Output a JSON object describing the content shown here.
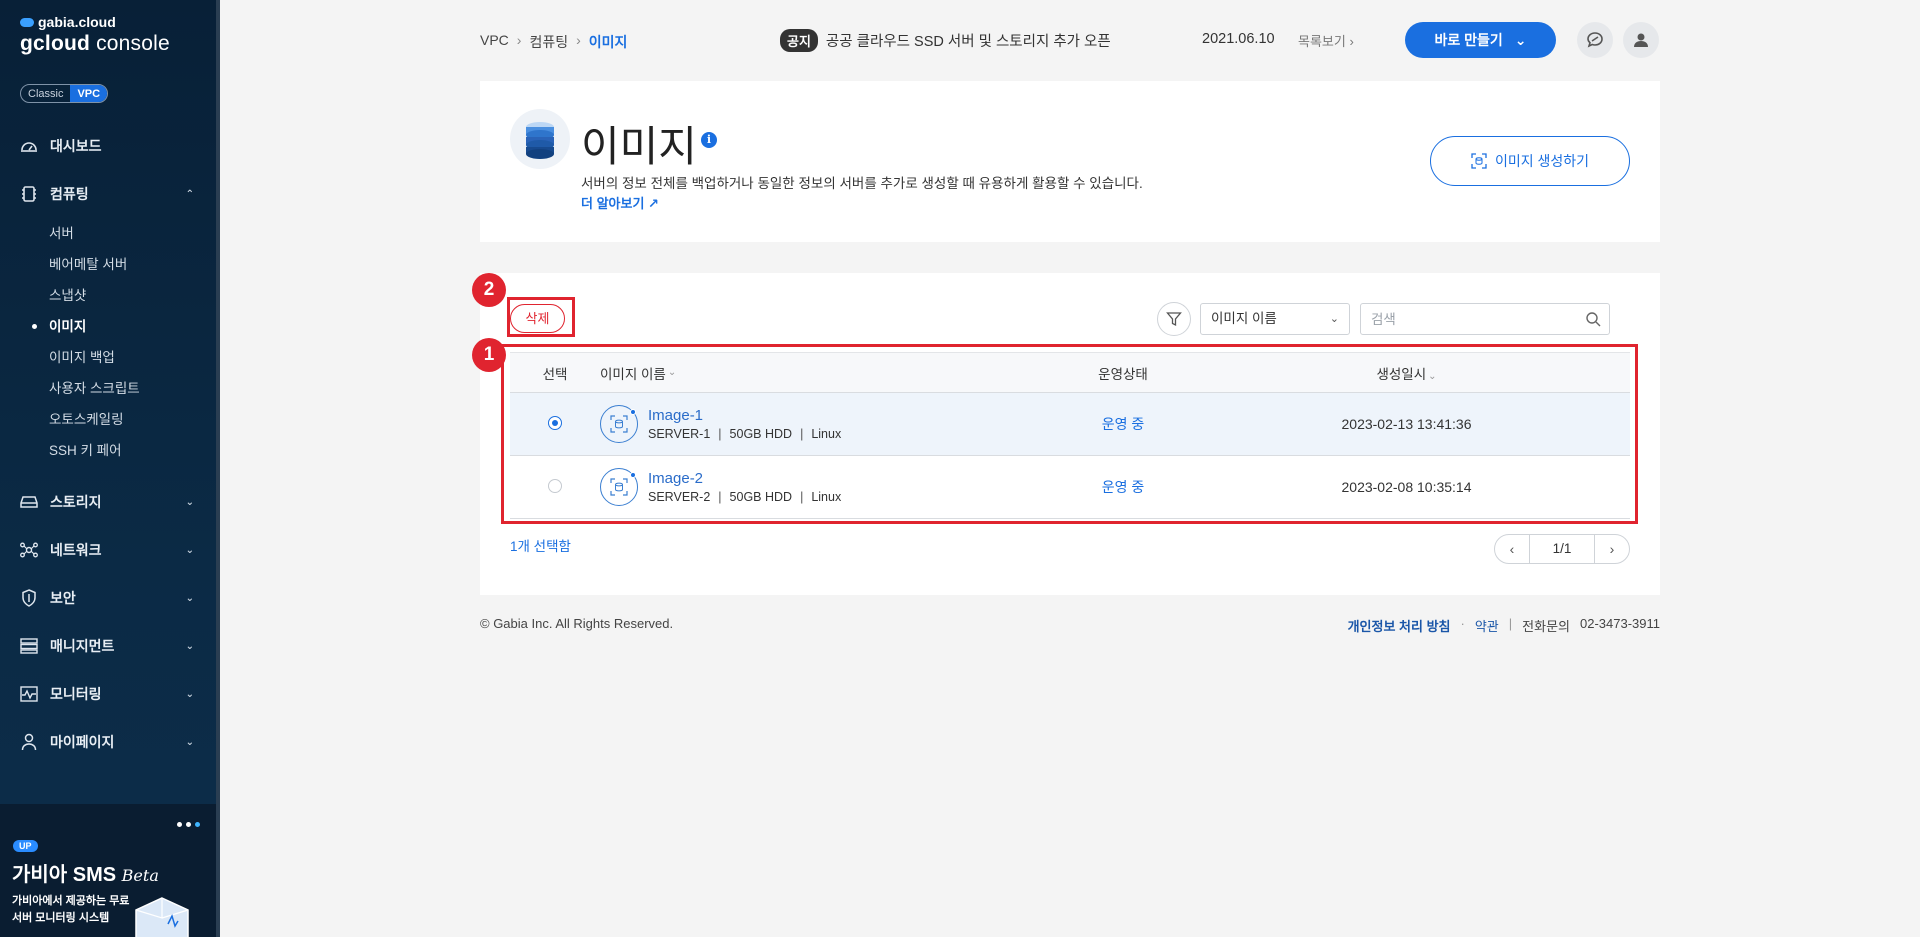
{
  "sidebar": {
    "brand_top": "gabia.cloud",
    "brand_main_bold": "gcloud",
    "brand_main_rest": " console",
    "toggle": {
      "classic": "Classic",
      "vpc": "VPC"
    },
    "items": [
      {
        "label": "대시보드",
        "icon": "dashboard-icon"
      },
      {
        "label": "컴퓨팅",
        "icon": "chip-icon",
        "expanded": true,
        "children": [
          "서버",
          "베어메탈 서버",
          "스냅샷",
          "이미지",
          "이미지 백업",
          "사용자 스크립트",
          "오토스케일링",
          "SSH 키 페어"
        ],
        "active_child": "이미지"
      },
      {
        "label": "스토리지",
        "icon": "storage-icon"
      },
      {
        "label": "네트워크",
        "icon": "network-icon"
      },
      {
        "label": "보안",
        "icon": "shield-icon"
      },
      {
        "label": "매니지먼트",
        "icon": "management-icon"
      },
      {
        "label": "모니터링",
        "icon": "monitoring-icon"
      },
      {
        "label": "마이페이지",
        "icon": "user-icon"
      }
    ],
    "promo": {
      "badge": "UP",
      "title": "가비아 SMS",
      "title_suffix": "Beta",
      "desc": "가비아에서 제공하는 무료 서버 모니터링 시스템"
    }
  },
  "topbar": {
    "breadcrumb": [
      "VPC",
      "컴퓨팅",
      "이미지"
    ],
    "notice_tag": "공지",
    "notice_text": "공공 클라우드 SSD 서버 및 스토리지 추가 오픈",
    "notice_date": "2021.06.10",
    "notice_more": "목록보기",
    "create_button": "바로 만들기"
  },
  "header": {
    "title": "이미지",
    "description": "서버의 정보 전체를 백업하거나 동일한 정보의 서버를 추가로 생성할 때 유용하게 활용할 수 있습니다.",
    "learn_more": "더 알아보기",
    "create_image_button": "이미지 생성하기"
  },
  "list": {
    "delete_button": "삭제",
    "filter_select": "이미지 이름",
    "search_placeholder": "검색",
    "columns": {
      "select": "선택",
      "name": "이미지 이름",
      "status": "운영상태",
      "created": "생성일시"
    },
    "rows": [
      {
        "name": "Image-1",
        "server": "SERVER-1",
        "disk": "50GB HDD",
        "os": "Linux",
        "status": "운영 중",
        "created": "2023-02-13 13:41:36",
        "selected": true
      },
      {
        "name": "Image-2",
        "server": "SERVER-2",
        "disk": "50GB HDD",
        "os": "Linux",
        "status": "운영 중",
        "created": "2023-02-08 10:35:14",
        "selected": false
      }
    ],
    "selected_count": "1개 선택함",
    "page": "1/1"
  },
  "annotations": {
    "badge_1": "1",
    "badge_2": "2",
    "color": "#e0242f"
  },
  "footer": {
    "copyright": "© Gabia Inc. All Rights Reserved.",
    "privacy": "개인정보 처리 방침",
    "terms": "약관",
    "phone_label": "전화문의",
    "phone": "02-3473-3911"
  }
}
